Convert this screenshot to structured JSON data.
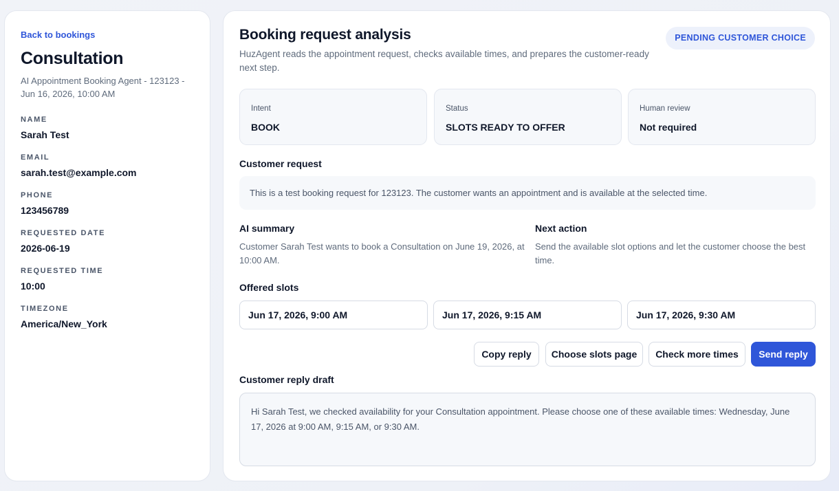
{
  "sidebar": {
    "back_link": "Back to bookings",
    "title": "Consultation",
    "subtitle": "AI Appointment Booking Agent - 123123 - Jun 16, 2026, 10:00 AM",
    "fields": [
      {
        "label": "NAME",
        "value": "Sarah Test"
      },
      {
        "label": "EMAIL",
        "value": "sarah.test@example.com"
      },
      {
        "label": "PHONE",
        "value": "123456789"
      },
      {
        "label": "REQUESTED DATE",
        "value": "2026-06-19"
      },
      {
        "label": "REQUESTED TIME",
        "value": "10:00"
      },
      {
        "label": "TIMEZONE",
        "value": "America/New_York"
      }
    ]
  },
  "main": {
    "title": "Booking request analysis",
    "description": "HuzAgent reads the appointment request, checks available times, and prepares the customer-ready next step.",
    "status_badge": "PENDING CUSTOMER CHOICE",
    "stats": [
      {
        "label": "Intent",
        "value": "BOOK"
      },
      {
        "label": "Status",
        "value": "SLOTS READY TO OFFER"
      },
      {
        "label": "Human review",
        "value": "Not required"
      }
    ],
    "customer_request": {
      "heading": "Customer request",
      "text": "This is a test booking request for 123123. The customer wants an appointment and is available at the selected time."
    },
    "ai_summary": {
      "heading": "AI summary",
      "text": "Customer Sarah Test wants to book a Consultation on June 19, 2026, at 10:00 AM."
    },
    "next_action": {
      "heading": "Next action",
      "text": "Send the available slot options and let the customer choose the best time."
    },
    "offered_slots": {
      "heading": "Offered slots",
      "slots": [
        "Jun 17, 2026, 9:00 AM",
        "Jun 17, 2026, 9:15 AM",
        "Jun 17, 2026, 9:30 AM"
      ]
    },
    "actions": {
      "copy_reply": "Copy reply",
      "choose_slots_page": "Choose slots page",
      "check_more_times": "Check more times",
      "send_reply": "Send reply"
    },
    "reply_draft": {
      "heading": "Customer reply draft",
      "text": "Hi Sarah Test, we checked availability for your Consultation appointment. Please choose one of these available times: Wednesday, June 17, 2026 at 9:00 AM, 9:15 AM, or 9:30 AM."
    }
  },
  "colors": {
    "accent": "#2f56d9",
    "badge_bg": "#edf1fb",
    "card_bg": "#ffffff",
    "page_bg": "#f1f3f8"
  }
}
